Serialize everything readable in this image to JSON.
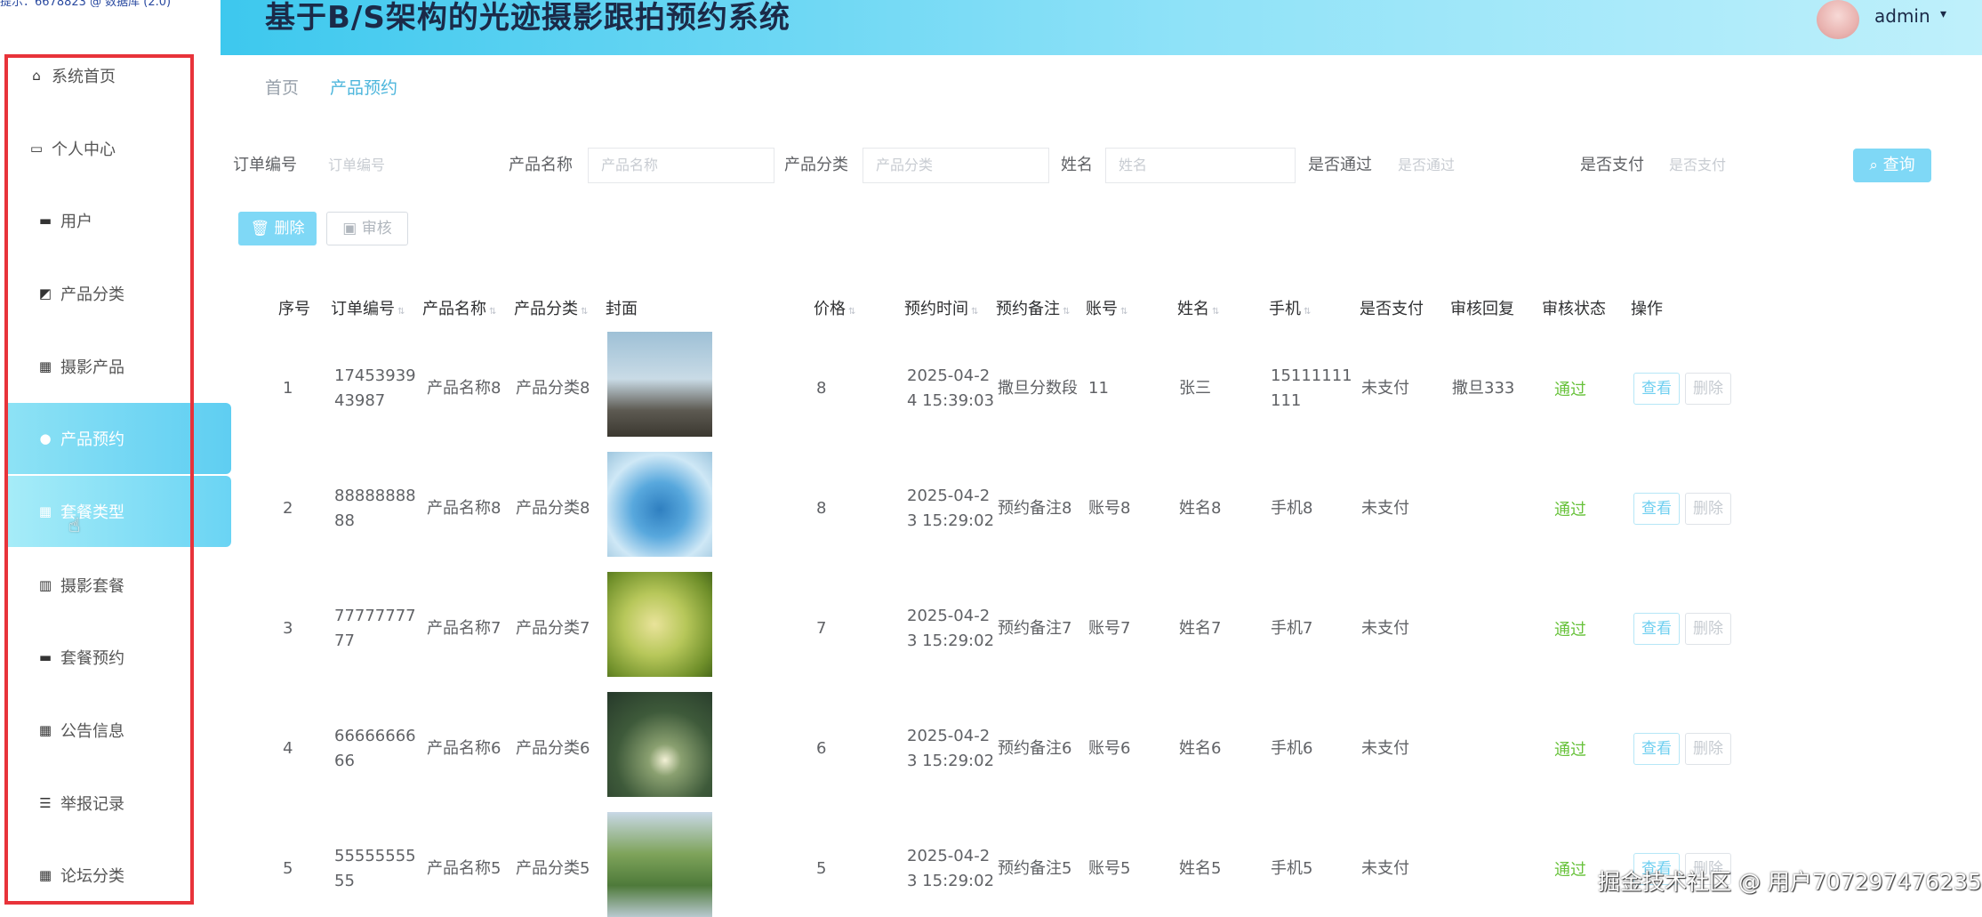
{
  "top_strip": "提示：6678823 @ 数据库 (2.0)",
  "header": {
    "title": "基于B/S架构的光迹摄影跟拍预约系统",
    "username": "admin",
    "caret": "▾"
  },
  "sidebar": {
    "items": [
      {
        "label": "系统首页",
        "icon": "home-icon",
        "glyph": "⌂"
      },
      {
        "label": "个人中心",
        "icon": "user-card-icon",
        "glyph": "▭"
      },
      {
        "label": "用户",
        "icon": "briefcase-icon",
        "glyph": "▬"
      },
      {
        "label": "产品分类",
        "icon": "chart-icon",
        "glyph": "◩"
      },
      {
        "label": "摄影产品",
        "icon": "grid-icon",
        "glyph": "▦"
      },
      {
        "label": "产品预约",
        "icon": "bulb-icon",
        "glyph": "●"
      },
      {
        "label": "套餐类型",
        "icon": "grid-icon",
        "glyph": "▦"
      },
      {
        "label": "摄影套餐",
        "icon": "book-icon",
        "glyph": "▥"
      },
      {
        "label": "套餐预约",
        "icon": "wallet-icon",
        "glyph": "▬"
      },
      {
        "label": "公告信息",
        "icon": "grid-icon",
        "glyph": "▦"
      },
      {
        "label": "举报记录",
        "icon": "sliders-icon",
        "glyph": "☰"
      },
      {
        "label": "论坛分类",
        "icon": "grid-icon",
        "glyph": "▦"
      }
    ]
  },
  "breadcrumb": {
    "home": "首页",
    "current": "产品预约"
  },
  "search": {
    "order_no_label": "订单编号",
    "order_no_placeholder": "订单编号",
    "product_name_label": "产品名称",
    "product_name_placeholder": "产品名称",
    "category_label": "产品分类",
    "category_placeholder": "产品分类",
    "name_label": "姓名",
    "name_placeholder": "姓名",
    "passed_label": "是否通过",
    "passed_placeholder": "是否通过",
    "paid_label": "是否支付",
    "paid_placeholder": "是否支付",
    "query_label": "查询"
  },
  "toolbar": {
    "delete_label": "删除",
    "audit_label": "审核"
  },
  "table": {
    "headers": [
      "序号",
      "订单编号",
      "产品名称",
      "产品分类",
      "封面",
      "价格",
      "预约时间",
      "预约备注",
      "账号",
      "姓名",
      "手机",
      "是否支付",
      "审核回复",
      "审核状态",
      "操作"
    ],
    "rows": [
      {
        "idx": "1",
        "order_a": "17453939",
        "order_b": "43987",
        "product": "产品名称8",
        "category": "产品分类8",
        "price": "8",
        "time_a": "2025-04-2",
        "time_b": "4 15:39:03",
        "remark": "撒旦分数段",
        "account": "11",
        "name": "张三",
        "phone_a": "15111111",
        "phone_b": "111",
        "paid": "未支付",
        "reply": "撒旦333",
        "status": "通过",
        "cover": "egret"
      },
      {
        "idx": "2",
        "order_a": "88888888",
        "order_b": "88",
        "product": "产品名称8",
        "category": "产品分类8",
        "price": "8",
        "time_a": "2025-04-2",
        "time_b": "3 15:29:02",
        "remark": "预约备注8",
        "account": "账号8",
        "name": "姓名8",
        "phone_a": "手机8",
        "phone_b": "",
        "paid": "未支付",
        "reply": "",
        "status": "通过",
        "cover": "ice"
      },
      {
        "idx": "3",
        "order_a": "77777777",
        "order_b": "77",
        "product": "产品名称7",
        "category": "产品分类7",
        "price": "7",
        "time_a": "2025-04-2",
        "time_b": "3 15:29:02",
        "remark": "预约备注7",
        "account": "账号7",
        "name": "姓名7",
        "phone_a": "手机7",
        "phone_b": "",
        "paid": "未支付",
        "reply": "",
        "status": "通过",
        "cover": "butterfly"
      },
      {
        "idx": "4",
        "order_a": "66666666",
        "order_b": "66",
        "product": "产品名称6",
        "category": "产品分类6",
        "price": "6",
        "time_a": "2025-04-2",
        "time_b": "3 15:29:02",
        "remark": "预约备注6",
        "account": "账号6",
        "name": "姓名6",
        "phone_a": "手机6",
        "phone_b": "",
        "paid": "未支付",
        "reply": "",
        "status": "通过",
        "cover": "lotus"
      },
      {
        "idx": "5",
        "order_a": "55555555",
        "order_b": "55",
        "product": "产品名称5",
        "category": "产品分类5",
        "price": "5",
        "time_a": "2025-04-2",
        "time_b": "3 15:29:02",
        "remark": "预约备注5",
        "account": "账号5",
        "name": "姓名5",
        "phone_a": "手机5",
        "phone_b": "",
        "paid": "未支付",
        "reply": "",
        "status": "通过",
        "cover": "garden"
      }
    ],
    "view_label": "查看",
    "delete_label": "删除"
  },
  "watermark": "掘金技术社区 @ 用户707297476235",
  "colors": {
    "accent": "#5fcef2",
    "pass": "#67c23a",
    "highlight_border": "#e8333a"
  }
}
